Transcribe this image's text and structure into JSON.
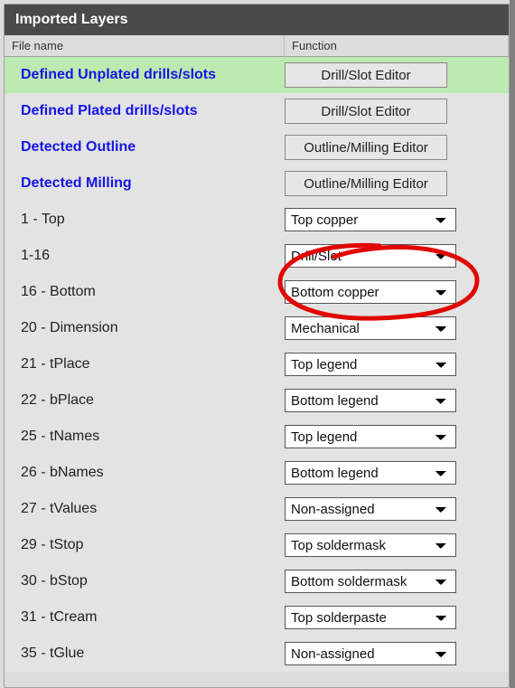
{
  "panel": {
    "title": "Imported Layers"
  },
  "headers": {
    "file": "File name",
    "func": "Function"
  },
  "rows": [
    {
      "name": "Defined Unplated drills/slots",
      "link": true,
      "highlight": true,
      "type": "button",
      "action": "Drill/Slot Editor"
    },
    {
      "name": "Defined Plated drills/slots",
      "link": true,
      "type": "button",
      "action": "Drill/Slot Editor"
    },
    {
      "name": "Detected Outline",
      "link": true,
      "type": "button",
      "action": "Outline/Milling Editor"
    },
    {
      "name": "Detected Milling",
      "link": true,
      "type": "button",
      "action": "Outline/Milling Editor"
    },
    {
      "name": "1 - Top",
      "type": "select",
      "value": "Top copper"
    },
    {
      "name": "1-16",
      "type": "select",
      "value": "Drill/Slot"
    },
    {
      "name": "16 - Bottom",
      "type": "select",
      "value": "Bottom copper"
    },
    {
      "name": "20 - Dimension",
      "type": "select",
      "value": "Mechanical"
    },
    {
      "name": "21 - tPlace",
      "type": "select",
      "value": "Top legend"
    },
    {
      "name": "22 - bPlace",
      "type": "select",
      "value": "Bottom legend"
    },
    {
      "name": "25 - tNames",
      "type": "select",
      "value": "Top legend"
    },
    {
      "name": "26 - bNames",
      "type": "select",
      "value": "Bottom legend"
    },
    {
      "name": "27 - tValues",
      "type": "select",
      "value": "Non-assigned"
    },
    {
      "name": "29 - tStop",
      "type": "select",
      "value": "Top soldermask"
    },
    {
      "name": "30 - bStop",
      "type": "select",
      "value": "Bottom soldermask"
    },
    {
      "name": "31 - tCream",
      "type": "select",
      "value": "Top solderpaste"
    },
    {
      "name": "35 - tGlue",
      "type": "select",
      "value": "Non-assigned"
    }
  ],
  "annotation": {
    "circled_row_index": 5
  }
}
